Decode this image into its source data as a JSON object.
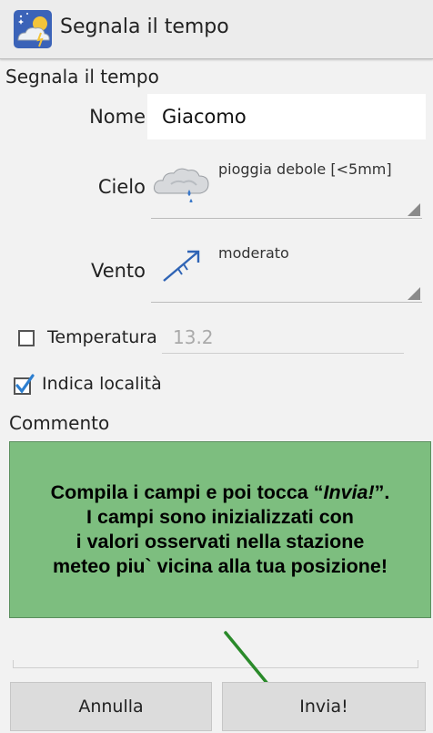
{
  "app": {
    "title": "Segnala il tempo",
    "icon": "weather-app-icon"
  },
  "form": {
    "section_title": "Segnala il tempo",
    "nome": {
      "label": "Nome",
      "value": "Giacomo"
    },
    "cielo": {
      "label": "Cielo",
      "value": "pioggia debole [<5mm]",
      "icon": "cloud-rain-icon"
    },
    "vento": {
      "label": "Vento",
      "value": "moderato",
      "icon": "wind-arrow-icon"
    },
    "temperatura": {
      "label": "Temperatura",
      "placeholder": "13.2",
      "checked": false
    },
    "localita": {
      "label": "Indica località",
      "checked": true
    },
    "commento": {
      "label": "Commento",
      "value": ""
    }
  },
  "callout": {
    "line1_a": "Compila i campi e poi tocca “",
    "line1_em": "Invia!",
    "line1_b": "”.",
    "line2": "I campi sono inizializzati con",
    "line3": "i valori osservati nella stazione",
    "line4": "meteo piu` vicina alla tua posizione!",
    "bg_color": "#7dbe7f",
    "arrow_color": "#2a8a2a"
  },
  "buttons": {
    "cancel": "Annulla",
    "submit": "Invia!"
  }
}
